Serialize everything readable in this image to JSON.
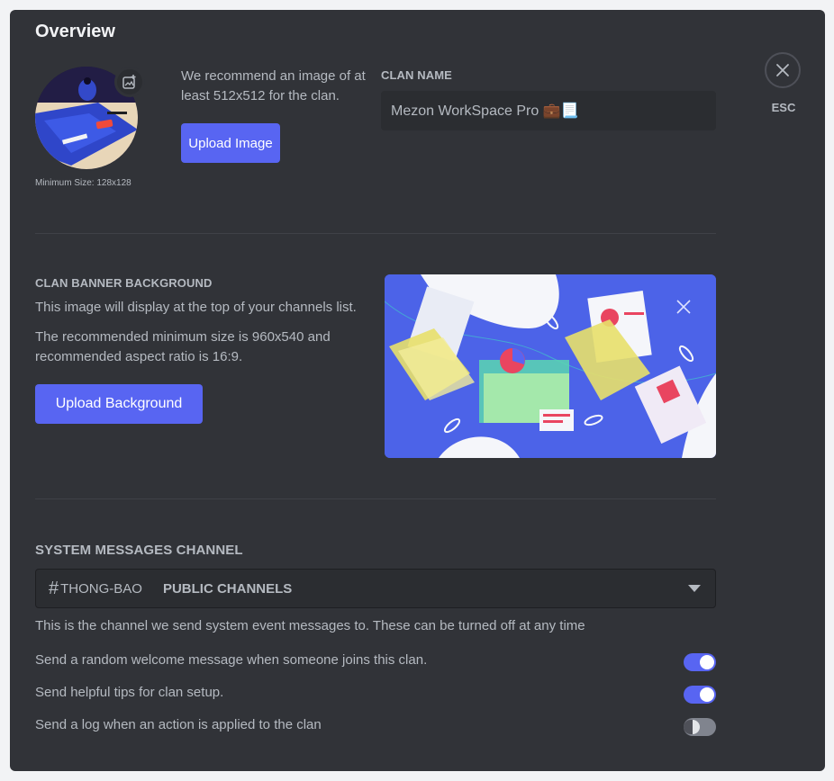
{
  "page": {
    "title": "Overview",
    "esc_label": "ESC"
  },
  "avatar": {
    "min_size": "Minimum Size: 128x128",
    "recommend": "We recommend an image of at least 512x512 for the clan.",
    "upload_label": "Upload Image"
  },
  "clan_name": {
    "label": "CLAN NAME",
    "value": "Mezon WorkSpace Pro 💼📃"
  },
  "banner": {
    "label": "CLAN BANNER BACKGROUND",
    "desc1": "This image will display at the top of your channels list.",
    "desc2": "The recommended minimum size is 960x540 and recommended aspect ratio is 16:9.",
    "upload_label": "Upload Background"
  },
  "system": {
    "label": "SYSTEM MESSAGES CHANNEL",
    "channel_hash": "#",
    "channel_name": "THONG-BAO",
    "channel_category": "PUBLIC CHANNELS",
    "help": "This is the channel we send system event messages to. These can be turned off at any time",
    "toggles": [
      {
        "label": "Send a random welcome message when someone joins this clan.",
        "on": true
      },
      {
        "label": "Send helpful tips for clan setup.",
        "on": true
      },
      {
        "label": "Send a log when an action is applied to the clan",
        "on": false
      }
    ]
  },
  "colors": {
    "accent": "#5865f2",
    "panel": "#313338",
    "input": "#2b2d31"
  }
}
